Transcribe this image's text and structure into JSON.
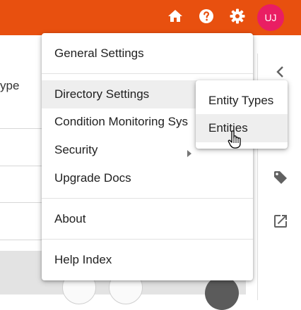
{
  "header": {
    "home_icon": "home-icon",
    "help_icon": "help-icon",
    "settings_icon": "gear-icon",
    "avatar_initials": "UJ",
    "bar_color": "#e8500f",
    "avatar_color": "#e91e63"
  },
  "background": {
    "column_header": "ype"
  },
  "right_panel": {
    "icons": [
      "chevron-left-icon",
      "tag-icon",
      "open-in-new-icon"
    ]
  },
  "menu": {
    "general_settings": "General Settings",
    "directory_settings": "Directory Settings",
    "condition_monitoring": "Condition Monitoring Sys",
    "security": "Security",
    "upgrade_docs": "Upgrade Docs",
    "about": "About",
    "help_index": "Help Index"
  },
  "submenu": {
    "entity_types": "Entity Types",
    "entities": "Entities"
  }
}
